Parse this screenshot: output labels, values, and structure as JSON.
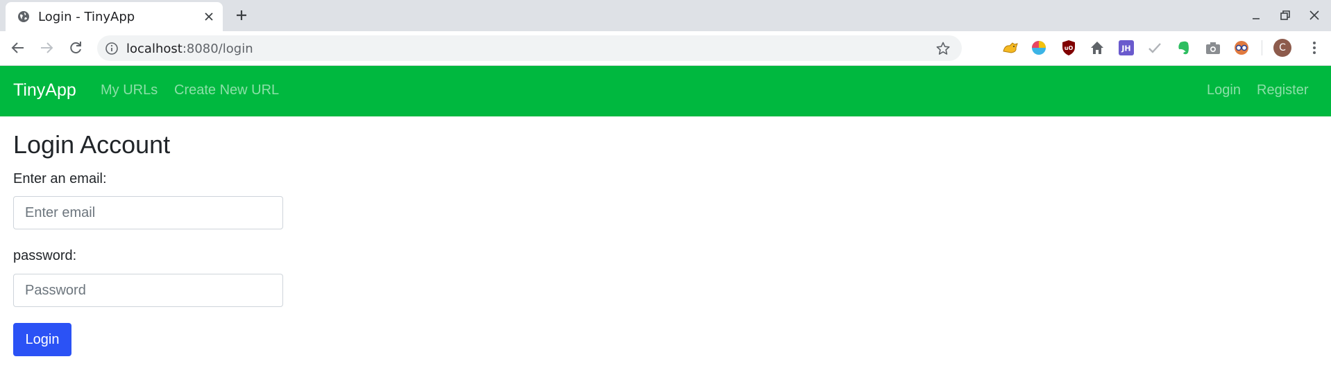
{
  "browser": {
    "tab_title": "Login - TinyApp",
    "url_host": "localhost",
    "url_rest": ":8080/login",
    "avatar_letter": "C",
    "extensions": [
      "cat-extension-icon",
      "colorful-extension-icon",
      "ublock-icon",
      "home-icon",
      "jh-extension-icon",
      "check-icon",
      "evernote-icon",
      "camera-icon",
      "glasses-extension-icon"
    ]
  },
  "navbar": {
    "brand": "TinyApp",
    "links": {
      "my_urls": "My URLs",
      "create_new_url": "Create New URL",
      "login": "Login",
      "register": "Register"
    },
    "color": "#00b83f"
  },
  "form": {
    "title": "Login Account",
    "email_label": "Enter an email:",
    "email_placeholder": "Enter email",
    "password_label": "password:",
    "password_placeholder": "Password",
    "submit_label": "Login",
    "button_color": "#2b52f5"
  }
}
